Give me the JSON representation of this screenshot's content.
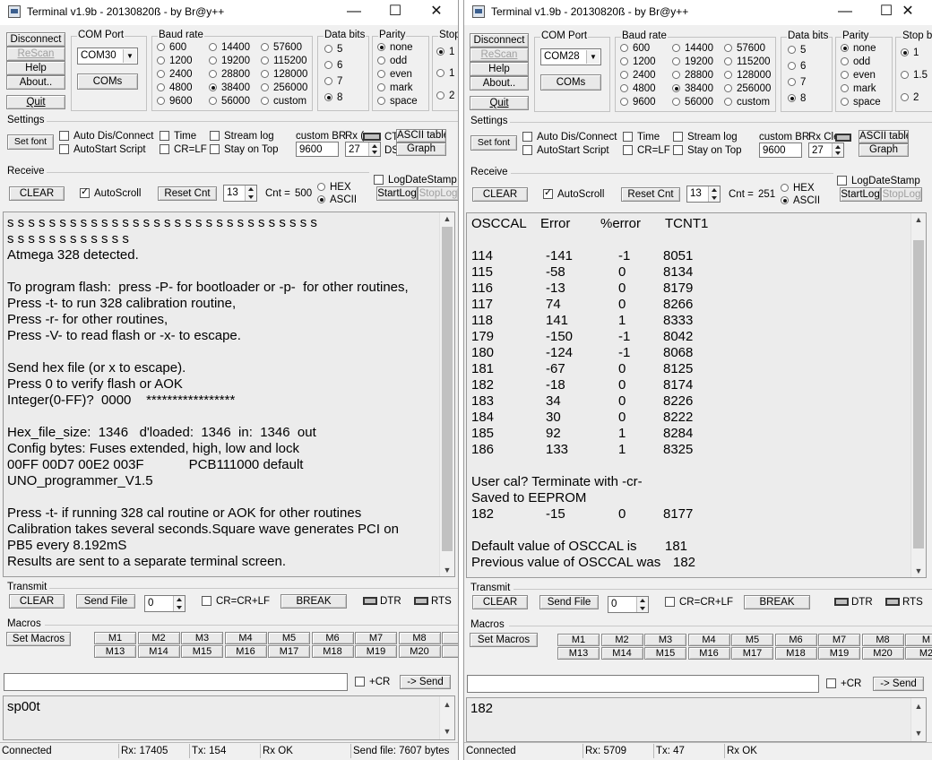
{
  "left": {
    "title": "Terminal v1.9b - 20130820ß - by Br@y++",
    "controls": {
      "disconnect": "Disconnect",
      "rescan": "ReScan",
      "help": "Help",
      "about": "About..",
      "quit": "Quit",
      "coms": "COMs"
    },
    "com_port": {
      "label": "COM Port",
      "value": "COM30"
    },
    "baud": {
      "label": "Baud rate",
      "options": [
        "600",
        "1200",
        "2400",
        "4800",
        "9600",
        "14400",
        "19200",
        "28800",
        "38400",
        "56000",
        "57600",
        "115200",
        "128000",
        "256000",
        "custom"
      ],
      "selected": "38400"
    },
    "data_bits": {
      "label": "Data bits",
      "options": [
        "5",
        "6",
        "7",
        "8"
      ],
      "selected": "8"
    },
    "parity": {
      "label": "Parity",
      "options": [
        "none",
        "odd",
        "even",
        "mark",
        "space"
      ],
      "selected": "none"
    },
    "stop": {
      "label": "Stop",
      "options": [
        "1",
        "1",
        "2"
      ]
    },
    "settings": {
      "label": "Settings",
      "set_font": "Set font",
      "auto_dis": "Auto Dis/Connect",
      "autostart": "AutoStart Script",
      "time": "Time",
      "crlf": "CR=LF",
      "stream_log": "Stream log",
      "stay_on_top": "Stay on Top",
      "custom_br": "custom BR",
      "custom_br_value": "9600",
      "rx": "Rx (",
      "rx_value": "27",
      "ct": "CT",
      "ds": "DS",
      "ascii_table": "ASCII table",
      "graph": "Graph"
    },
    "receive": {
      "label": "Receive",
      "clear": "CLEAR",
      "autoscroll": "AutoScroll",
      "reset_cnt": "Reset Cnt",
      "cnt_spin": "13",
      "cnt_label": "Cnt =",
      "cnt_value": "500",
      "hex": "HEX",
      "ascii": "ASCII",
      "log_date": "LogDateStamp",
      "start_log": "StartLog",
      "stop_log": "StopLog"
    },
    "terminal_lines": [
      "s s s s s s s s s s s s s s s s s s s s s s s s s s s s s s",
      "s s s s s s s s s s s s",
      "Atmega 328 detected.",
      "",
      "To program flash:  press -P- for bootloader or -p-  for other routines,",
      "Press -t- to run 328 calibration routine,",
      "Press -r- for other routines,",
      "Press -V- to read flash or -x- to escape.",
      "",
      "Send hex file (or x to escape).",
      "Press 0 to verify flash or AOK",
      "Integer(0-FF)?  0000    *****************",
      "",
      "Hex_file_size:  1346   d'loaded:  1346  in:  1346  out",
      "Config bytes: Fuses extended, high, low and lock",
      "00FF 00D7 00E2 003F            PCB111000 default",
      "UNO_programmer_V1.5",
      "",
      "Press -t- if running 328 cal routine or AOK for other routines",
      "Calibration takes several seconds.Square wave generates PCI on",
      "PB5 every 8.192mS",
      "Results are sent to a separate terminal screen."
    ],
    "transmit": {
      "label": "Transmit",
      "clear": "CLEAR",
      "send_file": "Send File",
      "spin": "0",
      "crcrlf": "CR=CR+LF",
      "break": "BREAK",
      "dtr": "DTR",
      "rts": "RTS"
    },
    "macros": {
      "label": "Macros",
      "set_macros": "Set Macros",
      "row1": [
        "M1",
        "M2",
        "M3",
        "M4",
        "M5",
        "M6",
        "M7",
        "M8",
        "M"
      ],
      "row2": [
        "M13",
        "M14",
        "M15",
        "M16",
        "M17",
        "M18",
        "M19",
        "M20",
        "M"
      ]
    },
    "send_input": "",
    "plus_cr": "+CR",
    "send_button": "-> Send",
    "output_text": "sp00t",
    "status": {
      "connected": "Connected",
      "rx": "Rx: 17405",
      "tx": "Tx: 154",
      "rxok": "Rx OK",
      "sendfile": "Send file: 7607 bytes"
    }
  },
  "right": {
    "title": "Terminal v1.9b - 20130820ß - by Br@y++",
    "controls": {
      "disconnect": "Disconnect",
      "rescan": "ReScan",
      "help": "Help",
      "about": "About..",
      "quit": "Quit",
      "coms": "COMs"
    },
    "com_port": {
      "label": "COM Port",
      "value": "COM28"
    },
    "baud": {
      "label": "Baud rate",
      "options": [
        "600",
        "1200",
        "2400",
        "4800",
        "9600",
        "14400",
        "19200",
        "28800",
        "38400",
        "56000",
        "57600",
        "115200",
        "128000",
        "256000",
        "custom"
      ],
      "selected": "38400"
    },
    "data_bits": {
      "label": "Data bits",
      "options": [
        "5",
        "6",
        "7",
        "8"
      ],
      "selected": "8"
    },
    "parity": {
      "label": "Parity",
      "options": [
        "none",
        "odd",
        "even",
        "mark",
        "space"
      ],
      "selected": "none"
    },
    "stop": {
      "label": "Stop bi",
      "options": [
        "1",
        "1.5",
        "2"
      ]
    },
    "settings": {
      "label": "Settings",
      "set_font": "Set font",
      "auto_dis": "Auto Dis/Connect",
      "autostart": "AutoStart Script",
      "time": "Time",
      "crlf": "CR=LF",
      "stream_log": "Stream log",
      "stay_on_top": "Stay on Top",
      "custom_br": "custom BR",
      "custom_br_value": "9600",
      "rx": "Rx Cle",
      "rx_value": "27",
      "ascii_table": "ASCII table",
      "graph": "Graph"
    },
    "receive": {
      "label": "Receive",
      "clear": "CLEAR",
      "autoscroll": "AutoScroll",
      "reset_cnt": "Reset Cnt",
      "cnt_spin": "13",
      "cnt_label": "Cnt =",
      "cnt_value": "251",
      "hex": "HEX",
      "ascii": "ASCII",
      "log_date": "LogDateStamp",
      "start_log": "StartLog",
      "stop_log": "StopLog"
    },
    "table_header": [
      "OSCCAL",
      "Error",
      "%error",
      "TCNT1"
    ],
    "table_rows": [
      [
        "114",
        "-141",
        "-1",
        "8051"
      ],
      [
        "115",
        "-58",
        "0",
        "8134"
      ],
      [
        "116",
        "-13",
        "0",
        "8179"
      ],
      [
        "117",
        "74",
        "0",
        "8266"
      ],
      [
        "118",
        "141",
        "1",
        "8333"
      ],
      [
        "179",
        "-150",
        "-1",
        "8042"
      ],
      [
        "180",
        "-124",
        "-1",
        "8068"
      ],
      [
        "181",
        "-67",
        "0",
        "8125"
      ],
      [
        "182",
        "-18",
        "0",
        "8174"
      ],
      [
        "183",
        "34",
        "0",
        "8226"
      ],
      [
        "184",
        "30",
        "0",
        "8222"
      ],
      [
        "185",
        "92",
        "1",
        "8284"
      ],
      [
        "186",
        "133",
        "1",
        "8325"
      ]
    ],
    "user_cal_1": "User cal? Terminate with -cr-",
    "user_cal_2": "Saved to EEPROM",
    "user_row": [
      "182",
      "-15",
      "0",
      "8177"
    ],
    "default_label": "Default value of OSCCAL is",
    "default_value": "181",
    "previous_label": "Previous value of OSCCAL was",
    "previous_value": "182",
    "transmit": {
      "label": "Transmit",
      "clear": "CLEAR",
      "send_file": "Send File",
      "spin": "0",
      "crcrlf": "CR=CR+LF",
      "break": "BREAK",
      "dtr": "DTR",
      "rts": "RTS"
    },
    "macros": {
      "label": "Macros",
      "set_macros": "Set Macros",
      "row1": [
        "M1",
        "M2",
        "M3",
        "M4",
        "M5",
        "M6",
        "M7",
        "M8",
        "M"
      ],
      "row2": [
        "M13",
        "M14",
        "M15",
        "M16",
        "M17",
        "M18",
        "M19",
        "M20",
        "M2"
      ]
    },
    "send_input": "",
    "plus_cr": "+CR",
    "send_button": "-> Send",
    "output_text": "182",
    "status": {
      "connected": "Connected",
      "rx": "Rx: 5709",
      "tx": "Tx: 47",
      "rxok": "Rx OK"
    }
  }
}
